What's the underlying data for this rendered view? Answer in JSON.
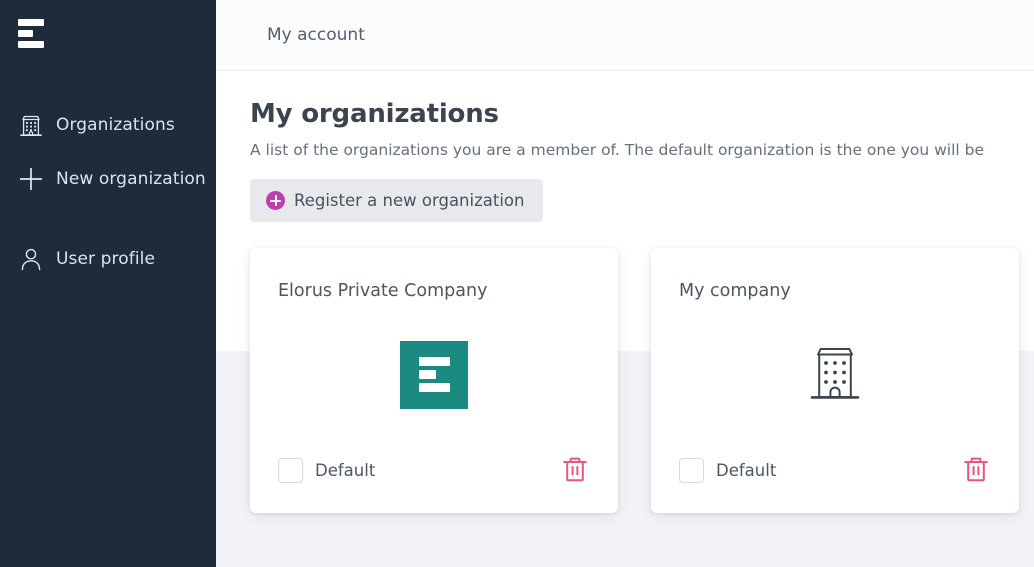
{
  "sidebar": {
    "logo_name": "elorus-logo",
    "items": [
      {
        "label": "Organizations",
        "icon": "building-icon"
      },
      {
        "label": "New organization",
        "icon": "plus-icon"
      },
      {
        "label": "User profile",
        "icon": "user-icon"
      }
    ]
  },
  "header": {
    "title": "My account"
  },
  "main": {
    "page_title": "My organizations",
    "description": "A list of the organizations you are a member of. The default organization is the one you will be",
    "register_button": "Register a new organization",
    "cards": [
      {
        "title": "Elorus Private Company",
        "logo_type": "elorus-logo-tile",
        "default_label": "Default",
        "default_checked": false,
        "delete_label": "delete-icon"
      },
      {
        "title": "My company",
        "logo_type": "building-placeholder",
        "default_label": "Default",
        "default_checked": false,
        "delete_label": "delete-icon"
      }
    ]
  },
  "colors": {
    "sidebar_bg": "#1f2a3a",
    "content_bg": "#f1f3f7",
    "accent_magenta": "#bd3fae",
    "org_logo_teal": "#1d8a82",
    "delete_pink": "#e8567e",
    "text_dark": "#3d4450"
  }
}
